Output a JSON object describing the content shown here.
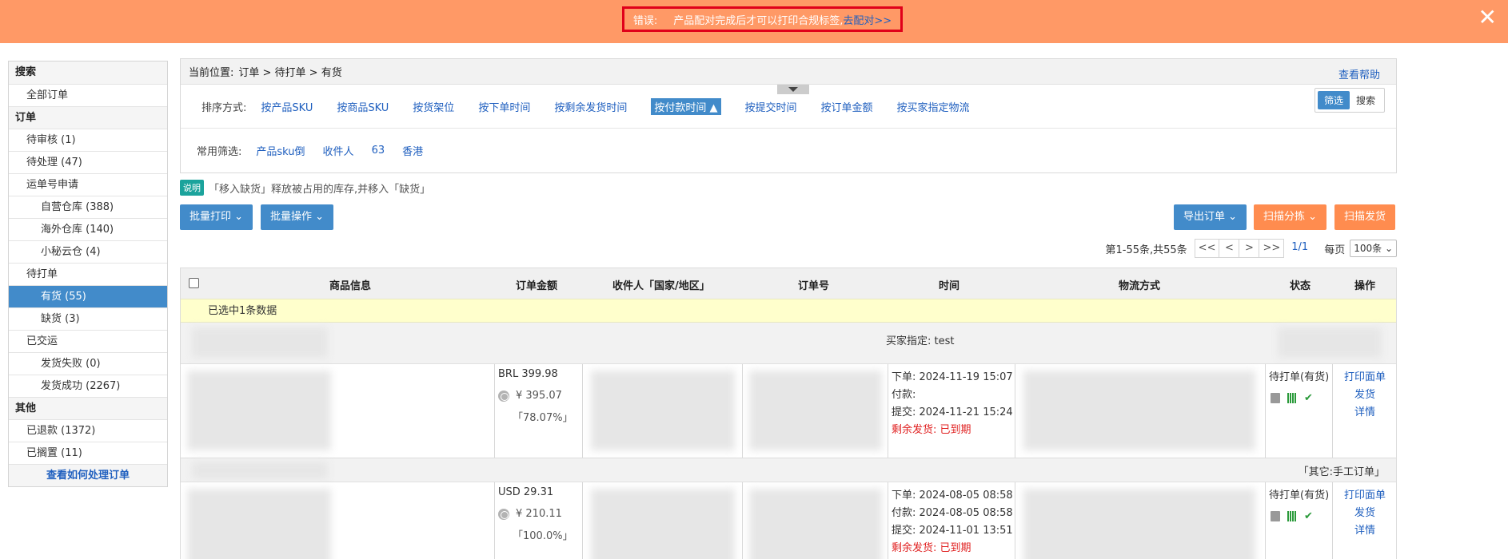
{
  "error_banner": {
    "label": "错误:",
    "message": "产品配对完成后才可以打印合规标签,",
    "link": "去配对>>",
    "close": "✕"
  },
  "sidebar": {
    "items": [
      {
        "label": "搜索",
        "kind": "head"
      },
      {
        "label": "全部订单",
        "kind": "item"
      },
      {
        "label": "订单",
        "kind": "head"
      },
      {
        "label": "待审核 (1)",
        "kind": "item"
      },
      {
        "label": "待处理 (47)",
        "kind": "item"
      },
      {
        "label": "运单号申请",
        "kind": "item"
      },
      {
        "label": "自营仓库 (388)",
        "kind": "sub"
      },
      {
        "label": "海外仓库 (140)",
        "kind": "sub"
      },
      {
        "label": "小秘云仓 (4)",
        "kind": "sub"
      },
      {
        "label": "待打单",
        "kind": "item"
      },
      {
        "label": "有货 (55)",
        "kind": "sub-active"
      },
      {
        "label": "缺货 (3)",
        "kind": "sub"
      },
      {
        "label": "已交运",
        "kind": "item"
      },
      {
        "label": "发货失败 (0)",
        "kind": "sub"
      },
      {
        "label": "发货成功 (2267)",
        "kind": "sub"
      },
      {
        "label": "其他",
        "kind": "head"
      },
      {
        "label": "已退款 (1372)",
        "kind": "item"
      },
      {
        "label": "已搁置 (11)",
        "kind": "item"
      },
      {
        "label": "查看如何处理订单",
        "kind": "link"
      }
    ]
  },
  "breadcrumb": {
    "prefix": "当前位置:",
    "path": "订单 > 待打单 > 有货"
  },
  "help_link": "查看帮助",
  "sort": {
    "label": "排序方式:",
    "options": [
      "按产品SKU",
      "按商品SKU",
      "按货架位",
      "按下单时间",
      "按剩余发货时间",
      "按付款时间",
      "按提交时间",
      "按订单金额",
      "按买家指定物流"
    ],
    "active_index": 5,
    "active_arrow": "▲"
  },
  "view_toggle": {
    "filter": "筛选",
    "search": "搜索"
  },
  "common_filters": {
    "label": "常用筛选:",
    "items": [
      "产品sku倒",
      "收件人",
      "63",
      "香港"
    ]
  },
  "note": {
    "badge": "说明",
    "text": "「移入缺货」释放被占用的库存,并移入「缺货」"
  },
  "actions": {
    "batch_print": "批量打印",
    "batch_ops": "批量操作",
    "export": "导出订单",
    "scan_sort": "扫描分拣",
    "scan_ship": "扫描发货",
    "caret": "⌄"
  },
  "pagination": {
    "summary": "第1-55条,共55条",
    "first": "<<",
    "prev": "<",
    "next": ">",
    "last": ">>",
    "current": "1/1",
    "per_page_label": "每页",
    "per_page": "100条",
    "select_caret": "⌄"
  },
  "table": {
    "headers": {
      "product": "商品信息",
      "amount": "订单金额",
      "recipient": "收件人「国家/地区」",
      "order_no": "订单号",
      "time": "时间",
      "logistics": "物流方式",
      "status": "状态",
      "ops": "操作"
    },
    "selected_text": "已选中1条数据",
    "groups": [
      {
        "text": "买家指定: test"
      },
      {
        "text": "「其它:手工订单」"
      }
    ],
    "orders": [
      {
        "amount": "BRL 399.98",
        "amount_cny": "¥ 395.07",
        "ratio": "「78.07%」",
        "time_order": "下单: 2024-11-19 15:07",
        "time_paid": "付款:",
        "time_submit": "提交: 2024-11-21 15:24",
        "time_remain": "剩余发货: 已到期",
        "status": "待打单(有货)",
        "op_print": "打印面单",
        "op_ship": "发货",
        "op_detail": "详情"
      },
      {
        "amount": "USD 29.31",
        "amount_cny": "¥ 210.11",
        "ratio": "「100.0%」",
        "time_order": "下单: 2024-08-05 08:58",
        "time_paid": "付款: 2024-08-05 08:58",
        "time_submit": "提交: 2024-11-01 13:51",
        "time_remain": "剩余发货: 已到期",
        "status": "待打单(有货)",
        "op_print": "打印面单",
        "op_ship": "发货",
        "op_detail": "详情"
      }
    ]
  }
}
